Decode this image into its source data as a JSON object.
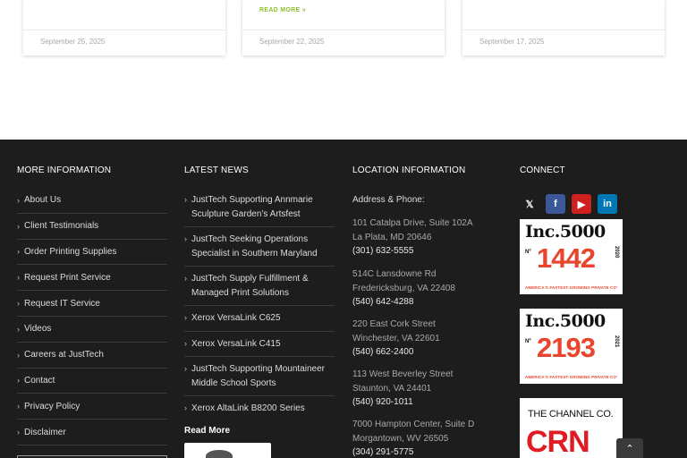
{
  "cards": [
    {
      "date": "September 25, 2025",
      "read_more": ""
    },
    {
      "date": "September 22, 2025",
      "read_more": "READ MORE »"
    },
    {
      "date": "September 17, 2025",
      "read_more": ""
    }
  ],
  "footer": {
    "more_info": {
      "title": "MORE INFORMATION",
      "items": [
        "About Us",
        "Client Testimonials",
        "Order Printing Supplies",
        "Request Print Service",
        "Request IT Service",
        "Videos",
        "Careers at JustTech",
        "Contact",
        "Privacy Policy",
        "Disclaimer"
      ]
    },
    "latest_news": {
      "title": "LATEST NEWS",
      "items": [
        "JustTech Supporting Annmarie Sculpture Garden’s Artsfest",
        "JustTech Seeking Operations Specialist in Southern Maryland",
        "JustTech Supply Fulfillment & Managed Print Solutions",
        "Xerox VersaLink C625",
        "Xerox VersaLink C415",
        "JustTech Supporting Mountaineer Middle School Sports",
        "Xerox AltaLink B8200 Series"
      ],
      "read_more": "Read More"
    },
    "location": {
      "title": "LOCATION INFORMATION",
      "heading": "Address & Phone:",
      "entries": [
        {
          "line1": "101 Catalpa Drive, Suite 102A",
          "line2": "La Plata, MD 20646",
          "phone": "(301) 632-5555"
        },
        {
          "line1": "514C Lansdowne Rd",
          "line2": "Fredericksburg, VA 22408",
          "phone": "(540) 642-4288"
        },
        {
          "line1": "220 East Cork Street",
          "line2": "Winchester, VA 22601",
          "phone": "(540) 662-2400"
        },
        {
          "line1": "113 West Beverley Street",
          "line2": "Staunton, VA 24401",
          "phone": "(540) 920-1011"
        },
        {
          "line1": "7000 Hampton Center, Suite D",
          "line2": "Morgantown, WV 26505",
          "phone": "(304) 291-5775"
        }
      ]
    },
    "connect": {
      "title": "CONNECT",
      "social": [
        {
          "icon": "x-icon",
          "glyph": "𝕏"
        },
        {
          "icon": "facebook-icon",
          "glyph": "f"
        },
        {
          "icon": "youtube-icon",
          "glyph": "▶"
        },
        {
          "icon": "linkedin-icon",
          "glyph": "in"
        }
      ],
      "badges": [
        {
          "brand": "Inc.5000",
          "no": "Nº",
          "rank": "1442",
          "year": "2020",
          "tagline": "AMERICA'S FASTEST-GROWING PRIVATE CO'"
        },
        {
          "brand": "Inc.5000",
          "no": "Nº",
          "rank": "2193",
          "year": "2021",
          "tagline": "AMERICA'S FASTEST-GROWING PRIVATE CO'"
        }
      ],
      "crn": {
        "channel": "THE CHANNEL CO.",
        "logo": "CRN"
      }
    },
    "scroll_top_glyph": "⌃"
  }
}
